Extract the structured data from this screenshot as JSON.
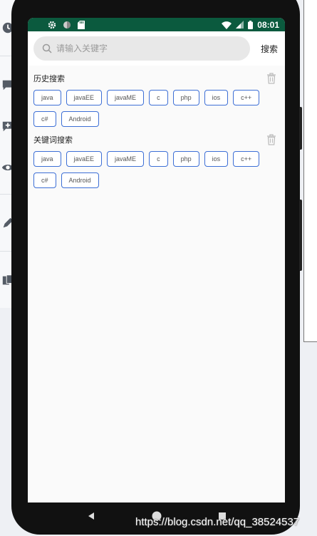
{
  "status_bar": {
    "time": "08:01",
    "left_icons": [
      "gear-icon",
      "circle-icon",
      "sd-card-icon"
    ],
    "right_icons": [
      "wifi-icon",
      "signal-icon",
      "battery-icon"
    ],
    "color": "#0b5a3e"
  },
  "search": {
    "placeholder": "请输入关键字",
    "button_label": "搜索"
  },
  "history": {
    "title": "历史搜索",
    "tags": [
      "java",
      "javaEE",
      "javaME",
      "c",
      "php",
      "ios",
      "c++",
      "c#",
      "Android"
    ]
  },
  "keywords": {
    "title": "关键词搜索",
    "tags": [
      "java",
      "javaEE",
      "javaME",
      "c",
      "php",
      "ios",
      "c++",
      "c#",
      "Android"
    ]
  },
  "watermark": "https://blog.csdn.net/qq_38524537",
  "colors": {
    "tag_border": "#3d6fd6",
    "accent": "#0b5a3e"
  }
}
